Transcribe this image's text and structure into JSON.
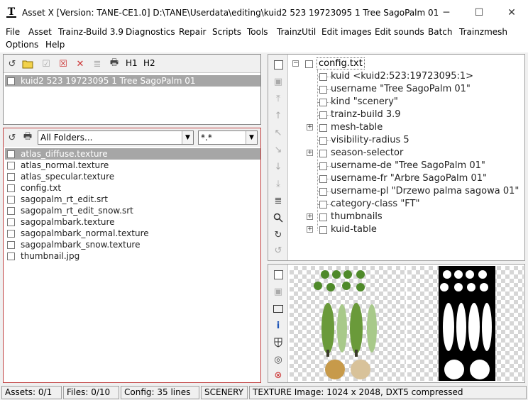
{
  "window": {
    "title": "Asset X  [Version: TANE-CE1.0]  D:\\TANE\\Userdata\\editing\\kuid2 523 19723095 1 Tree SagoPalm 01",
    "icon": "app-logo-icon",
    "minimize_glyph": "─",
    "maximize_glyph": "☐",
    "close_glyph": "✕"
  },
  "menu": {
    "items": [
      "File",
      "Asset",
      "Trainz-Build 3.9",
      "Diagnostics",
      "Repair",
      "Scripts",
      "Tools",
      "TrainzUtil",
      "Edit images",
      "Edit sounds",
      "Batch",
      "Trainzmesh",
      "Options",
      "Help"
    ]
  },
  "asset_panel": {
    "h1_label": "H1",
    "h2_label": "H2",
    "selected_asset": "kuid2 523 19723095 1 Tree SagoPalm 01"
  },
  "files_panel": {
    "folder_filter": "All Folders...",
    "file_filter": "*.*",
    "files": [
      "atlas_diffuse.texture",
      "atlas_normal.texture",
      "atlas_specular.texture",
      "config.txt",
      "sagopalm_rt_edit.srt",
      "sagopalm_rt_edit_snow.srt",
      "sagopalmbark.texture",
      "sagopalmbark_normal.texture",
      "sagopalmbark_snow.texture",
      "thumbnail.jpg"
    ],
    "selected_index": 0
  },
  "config_tree": {
    "root": "config.txt",
    "items": [
      {
        "label": "kuid <kuid2:523:19723095:1>",
        "expandable": false
      },
      {
        "label": "username \"Tree SagoPalm 01\"",
        "expandable": false
      },
      {
        "label": "kind \"scenery\"",
        "expandable": false
      },
      {
        "label": "trainz-build 3.9",
        "expandable": false
      },
      {
        "label": "mesh-table",
        "expandable": true
      },
      {
        "label": "visibility-radius 5",
        "expandable": false
      },
      {
        "label": "season-selector",
        "expandable": true
      },
      {
        "label": "username-de \"Tree SagoPalm 01\"",
        "expandable": false
      },
      {
        "label": "username-fr \"Arbre SagoPalm 01\"",
        "expandable": false
      },
      {
        "label": "username-pl \"Drzewo palma sagowa 01\"",
        "expandable": false
      },
      {
        "label": "category-class \"FT\"",
        "expandable": false
      },
      {
        "label": "thumbnails",
        "expandable": true
      },
      {
        "label": "kuid-table",
        "expandable": true
      }
    ]
  },
  "status": {
    "assets": "Assets: 0/1",
    "files": "Files: 0/10",
    "config": "Config: 35 lines",
    "kind": "SCENERY",
    "texture": "TEXTURE Image: 1024 x 2048, DXT5 compressed"
  }
}
